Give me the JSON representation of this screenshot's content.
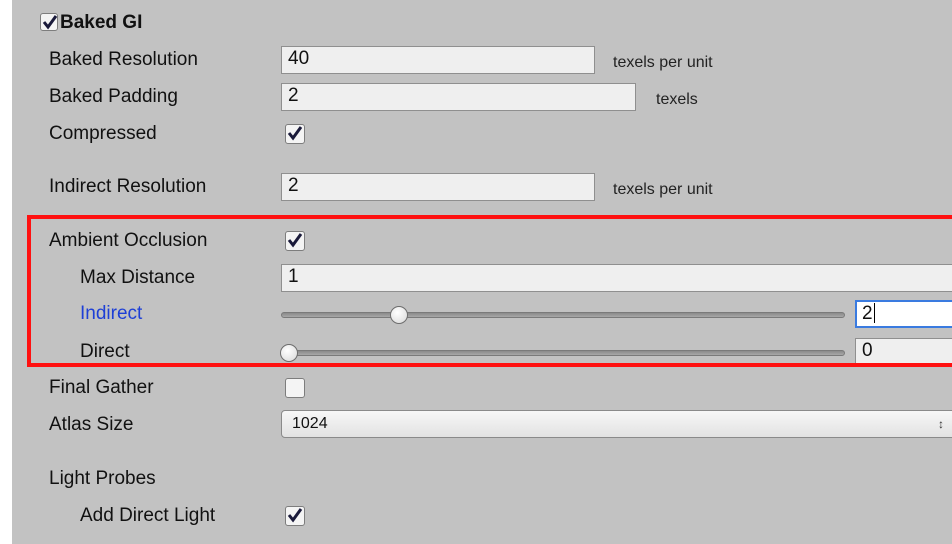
{
  "section": {
    "title": "Baked GI",
    "checked": true
  },
  "baked_resolution": {
    "label": "Baked Resolution",
    "value": "40",
    "unit": "texels per unit"
  },
  "baked_padding": {
    "label": "Baked Padding",
    "value": "2",
    "unit": "texels"
  },
  "compressed": {
    "label": "Compressed",
    "checked": true
  },
  "indirect_resolution": {
    "label": "Indirect Resolution",
    "value": "2",
    "unit": "texels per unit"
  },
  "ambient_occlusion": {
    "label": "Ambient Occlusion",
    "checked": true,
    "max_distance": {
      "label": "Max Distance",
      "value": "1"
    },
    "indirect": {
      "label": "Indirect",
      "value": "2",
      "slider_fraction": 0.2
    },
    "direct": {
      "label": "Direct",
      "value": "0",
      "slider_fraction": 0.0
    }
  },
  "final_gather": {
    "label": "Final Gather",
    "checked": false
  },
  "atlas_size": {
    "label": "Atlas Size",
    "value": "1024"
  },
  "light_probes": {
    "label": "Light Probes",
    "add_direct_light": {
      "label": "Add Direct Light",
      "checked": true
    }
  },
  "colors": {
    "highlight": "#ff1010",
    "focus_label": "#1d3fd6",
    "checkmark": "#1a1a3a"
  }
}
